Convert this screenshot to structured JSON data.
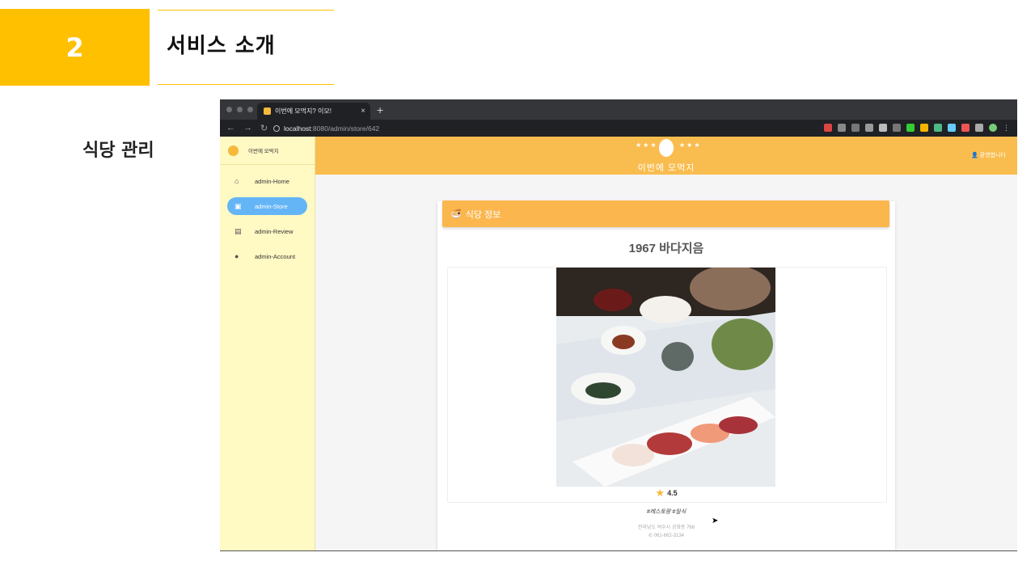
{
  "slide": {
    "number": "2",
    "title": "서비스 소개",
    "side_label": "식당 관리",
    "accent": "#FFC000"
  },
  "browser": {
    "tab_title": "이번에 모먹지? 이모!",
    "url_host": "localhost",
    "url_path": ":8080/admin/store/642"
  },
  "app": {
    "brand": "이번에 모먹지",
    "header_title": "이번에 모먹지",
    "user_label": "환영합니다",
    "primary_color": "#f9bd4f",
    "sidebar_bg": "#FFF9C4",
    "nav": [
      {
        "label": "admin-Home",
        "icon": "home-icon"
      },
      {
        "label": "admin-Store",
        "icon": "store-search-icon",
        "active": true
      },
      {
        "label": "admin-Review",
        "icon": "review-icon"
      },
      {
        "label": "admin-Account",
        "icon": "account-icon"
      }
    ],
    "card_title": "식당 정보",
    "store": {
      "name": "1967 바다지음",
      "rating": "4.5",
      "tags": "#레스토랑 #일식",
      "address": "전라남도 여수시 공화동 766",
      "phone": "061-662-3134"
    }
  }
}
